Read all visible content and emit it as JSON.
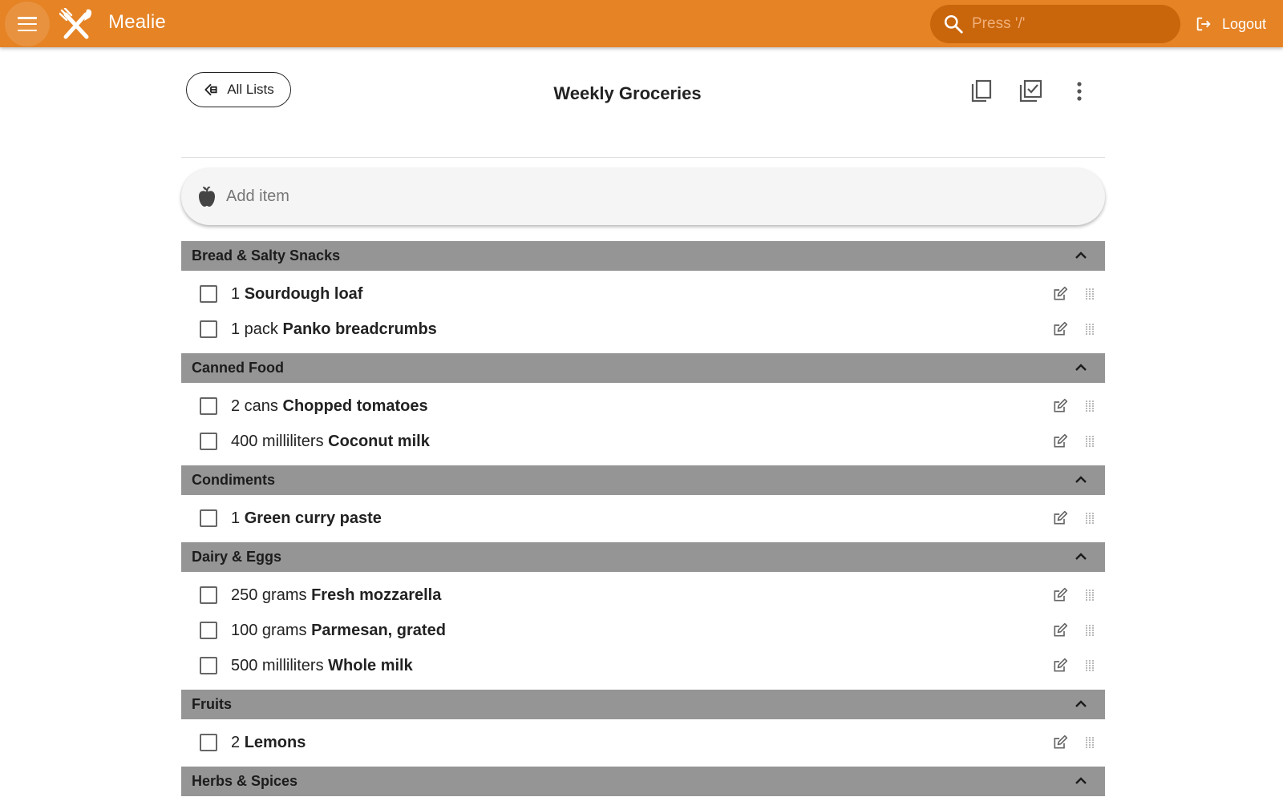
{
  "app": {
    "title": "Mealie"
  },
  "search": {
    "placeholder": "Press '/'"
  },
  "header": {
    "logout_label": "Logout"
  },
  "page": {
    "back_label": "All Lists",
    "title": "Weekly Groceries"
  },
  "add_item": {
    "placeholder": "Add item"
  },
  "categories": [
    {
      "name": "Bread & Salty Snacks",
      "items": [
        {
          "qty": "1",
          "name": "Sourdough loaf"
        },
        {
          "qty": "1 pack",
          "name": "Panko breadcrumbs"
        }
      ]
    },
    {
      "name": "Canned Food",
      "items": [
        {
          "qty": "2 cans",
          "name": "Chopped tomatoes"
        },
        {
          "qty": "400 milliliters",
          "name": "Coconut milk"
        }
      ]
    },
    {
      "name": "Condiments",
      "items": [
        {
          "qty": "1",
          "name": "Green curry paste"
        }
      ]
    },
    {
      "name": "Dairy & Eggs",
      "items": [
        {
          "qty": "250 grams",
          "name": "Fresh mozzarella"
        },
        {
          "qty": "100 grams",
          "name": "Parmesan, grated"
        },
        {
          "qty": "500 milliliters",
          "name": "Whole milk"
        }
      ]
    },
    {
      "name": "Fruits",
      "items": [
        {
          "qty": "2",
          "name": "Lemons"
        }
      ]
    },
    {
      "name": "Herbs & Spices",
      "items": []
    }
  ],
  "icons": {
    "menu": "menu-icon",
    "logo": "fork-knife-logo-icon",
    "search": "search-icon",
    "logout": "logout-icon",
    "back": "arrow-left-icon",
    "copy": "copy-icon",
    "check_all": "check-all-icon",
    "more": "more-vertical-icon",
    "add_item": "apple-icon",
    "collapse": "chevron-up-icon",
    "edit": "edit-icon",
    "drag": "drag-handle-icon"
  },
  "colors": {
    "primary": "#E58325",
    "search_bg": "#C9650B",
    "category_header": "#959595"
  }
}
